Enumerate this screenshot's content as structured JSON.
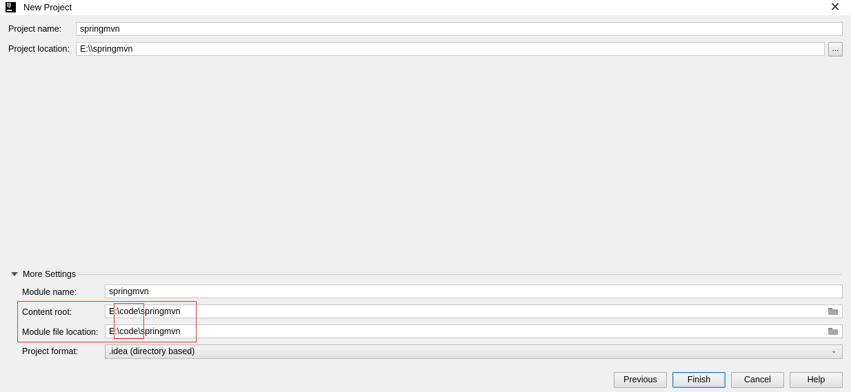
{
  "window": {
    "title": "New Project",
    "close_glyph": "✕",
    "app_icon": "intellij-idea-icon",
    "app_icon_text": "IJ"
  },
  "project": {
    "name_label": "Project name:",
    "name_value": "springmvn",
    "location_label": "Project location:",
    "location_value": "E:\\\\springmvn",
    "browse_label": "..."
  },
  "more_settings": {
    "header": "More Settings",
    "module_name_label": "Module name:",
    "module_name_value": "springmvn",
    "content_root_label": "Content root:",
    "content_root_value": "E:\\code\\springmvn",
    "module_file_label": "Module file location:",
    "module_file_value": "E:\\code\\springmvn",
    "project_format_label": "Project format:",
    "project_format_value": ".idea (directory based)"
  },
  "buttons": {
    "previous": "Previous",
    "finish": "Finish",
    "cancel": "Cancel",
    "help": "Help"
  },
  "annotation": {
    "color": "#e53935"
  },
  "colors": {
    "background": "#f0f0f0",
    "field": "#ffffff",
    "default_button_border": "#3c7fb1"
  }
}
